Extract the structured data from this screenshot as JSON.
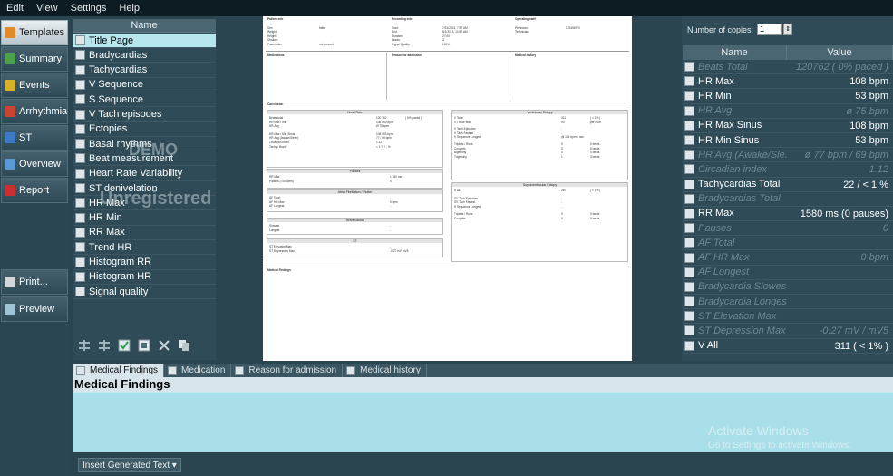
{
  "menu": [
    "Edit",
    "View",
    "Settings",
    "Help"
  ],
  "nav": [
    {
      "label": "Templates",
      "icon": "pencil-icon",
      "active": true
    },
    {
      "label": "Summary",
      "icon": "summary-icon",
      "active": false
    },
    {
      "label": "Events",
      "icon": "events-icon",
      "active": false
    },
    {
      "label": "Arrhythmias",
      "icon": "arrhythmias-icon",
      "active": false
    },
    {
      "label": "ST",
      "icon": "st-icon",
      "active": false
    },
    {
      "label": "Overview",
      "icon": "overview-icon",
      "active": false
    },
    {
      "label": "Report",
      "icon": "report-icon",
      "active": false
    },
    {
      "label": "Print...",
      "icon": "printer-icon",
      "active": false
    },
    {
      "label": "Preview",
      "icon": "preview-icon",
      "active": false
    }
  ],
  "list": {
    "header": "Name",
    "items": [
      "Title Page",
      "Bradycardias",
      "Tachycardias",
      "V Sequence",
      "S Sequence",
      "V Tach episodes",
      "Ectopies",
      "Basal rhythms",
      "Beat measurement",
      "Heart Rate Variability",
      "ST denivelation",
      "HR Max",
      "HR Min",
      "RR Max",
      "Trend HR",
      "Histogram RR",
      "Histogram HR",
      "Signal quality"
    ],
    "selected": 0,
    "watermark_demo": "DEMO",
    "watermark_unreg": "Unregistered"
  },
  "document": {
    "patient_info": "Patient info",
    "recording_info": "Recording info",
    "operating_staff": "Operating staff",
    "patient_labels": [
      "Sex:",
      "Weight:",
      "Height:",
      "Smoker:",
      "Pacemaker:"
    ],
    "patient_values": [
      "Male",
      "",
      "",
      "",
      "not present"
    ],
    "recording_labels": [
      "Start:",
      "End:",
      "Duration:",
      "Leads:",
      "Signal Quality:"
    ],
    "recording_values": [
      "7/31/2013, 7:57 AM",
      "8/1/2013, 10:57 AM",
      "27:00",
      "3",
      "100%"
    ],
    "staff_labels": [
      "Physician:",
      "Technician:"
    ],
    "staff_values": [
      "123456790",
      ""
    ],
    "medications": "Medications",
    "reason_for_admission": "Reason for admission",
    "medical_history": "Medical history",
    "conclusion": "Conclusion",
    "heart_rate": "Heart Rate",
    "hr_rows": [
      [
        "Beats total",
        "120 762",
        "( 0% paced )"
      ],
      [
        "HR max / min",
        "108 / 53 bpm",
        ""
      ],
      [
        "HR Avg",
        "Ø 75 bpm",
        ""
      ],
      [
        "HR Max / Min Sinus",
        "108 / 53 bpm",
        ""
      ],
      [
        "HR Avg (Awake/Sleep)",
        "77 / 69 bpm",
        ""
      ],
      [
        "Circadian index",
        "1.12",
        ""
      ],
      [
        "Tachy / Brady",
        "< 1 % / - %",
        ""
      ]
    ],
    "pauses": "Pauses",
    "pause_rows": [
      [
        "RR Max",
        "1 580 ms"
      ],
      [
        "Pauses (>2000ms)",
        "0"
      ]
    ],
    "af": "Atrial Fibrillation / Flutter",
    "af_rows": [
      [
        "AF Total",
        "-"
      ],
      [
        "AF HR Max",
        "0 bpm"
      ],
      [
        "AF Longest",
        "-"
      ]
    ],
    "bradycardia": "Bradycardia",
    "brady_rows": [
      [
        "Slowest",
        "-"
      ],
      [
        "Longest",
        "-"
      ]
    ],
    "st": "ST",
    "st_rows": [
      [
        "ST Elevation Max",
        "-"
      ],
      [
        "ST Depression Max",
        "-0.27 mV   mV5"
      ]
    ],
    "ventricular": "Ventricular Ectopy",
    "v_rows": [
      [
        "V Total",
        "311",
        "( < 1% )"
      ],
      [
        "V / Hour Max",
        "90",
        "per hour"
      ],
      [
        "V Tach Episodes",
        "-",
        ""
      ],
      [
        "V Tach Fastest",
        "-",
        ""
      ],
      [
        "V Sequence Longest",
        "@ 104 bpm   0 sec",
        ""
      ],
      [
        "Triplets / Runs",
        "0",
        "0 beats"
      ],
      [
        "Couplets",
        "3",
        "6 beats"
      ],
      [
        "Bigeminy",
        "0",
        "0 beats"
      ],
      [
        "Trigeminy",
        "1",
        "3 beats"
      ]
    ],
    "supraventricular": "Supraventricular Ectopy",
    "s_rows": [
      [
        "S All",
        "287",
        "( < 1% )"
      ],
      [
        "SV Tach Episodes",
        "-",
        ""
      ],
      [
        "SV Tach Fastest",
        "-",
        ""
      ],
      [
        "S Sequence Longest",
        "-",
        ""
      ],
      [
        "Triplets / Runs",
        "0",
        "0 beats"
      ],
      [
        "Couplets",
        "0",
        "0 beats"
      ]
    ],
    "medical_findings": "Medical Findings"
  },
  "right": {
    "copies_label": "Number of copies:",
    "copies_value": "1",
    "col_name": "Name",
    "col_value": "Value",
    "rows": [
      {
        "name": "Beats Total",
        "value": "120762 ( 0% paced )",
        "dim": true
      },
      {
        "name": "HR Max",
        "value": "108 bpm",
        "dim": false
      },
      {
        "name": "HR Min",
        "value": "53 bpm",
        "dim": false
      },
      {
        "name": "HR Avg",
        "value": "ø 75 bpm",
        "dim": true
      },
      {
        "name": "HR Max Sinus",
        "value": "108 bpm",
        "dim": false
      },
      {
        "name": "HR Min Sinus",
        "value": "53 bpm",
        "dim": false
      },
      {
        "name": "HR Avg (Awake/Sle...",
        "value": "ø 77 bpm / 69 bpm",
        "dim": true
      },
      {
        "name": "Circadian index",
        "value": "1.12",
        "dim": true
      },
      {
        "name": "Tachycardias Total",
        "value": "22 / < 1 %",
        "dim": false
      },
      {
        "name": "Bradycardias Total",
        "value": "",
        "dim": true
      },
      {
        "name": "RR Max",
        "value": "1580 ms (0 pauses)",
        "dim": false
      },
      {
        "name": "Pauses",
        "value": "0",
        "dim": true
      },
      {
        "name": "AF Total",
        "value": "",
        "dim": true
      },
      {
        "name": "AF HR Max",
        "value": "0 bpm",
        "dim": true
      },
      {
        "name": "AF Longest",
        "value": "",
        "dim": true
      },
      {
        "name": "Bradycardia Slowest",
        "value": "",
        "dim": true
      },
      {
        "name": "Bradycardia Longest",
        "value": "",
        "dim": true
      },
      {
        "name": "ST Elevation Max",
        "value": "",
        "dim": true
      },
      {
        "name": "ST Depression Max",
        "value": "-0.27 mV / mV5",
        "dim": true
      },
      {
        "name": "V All",
        "value": "311 ( < 1% )",
        "dim": false
      }
    ]
  },
  "bottom": {
    "tabs": [
      "Medical Findings",
      "Medication",
      "Reason for admission",
      "Medical history"
    ],
    "active_tab": 0,
    "title": "Medical Findings",
    "activate_title": "Activate Windows",
    "activate_sub": "Go to Settings to activate Windows.",
    "insert_button": "Insert Generated Text ▾"
  }
}
